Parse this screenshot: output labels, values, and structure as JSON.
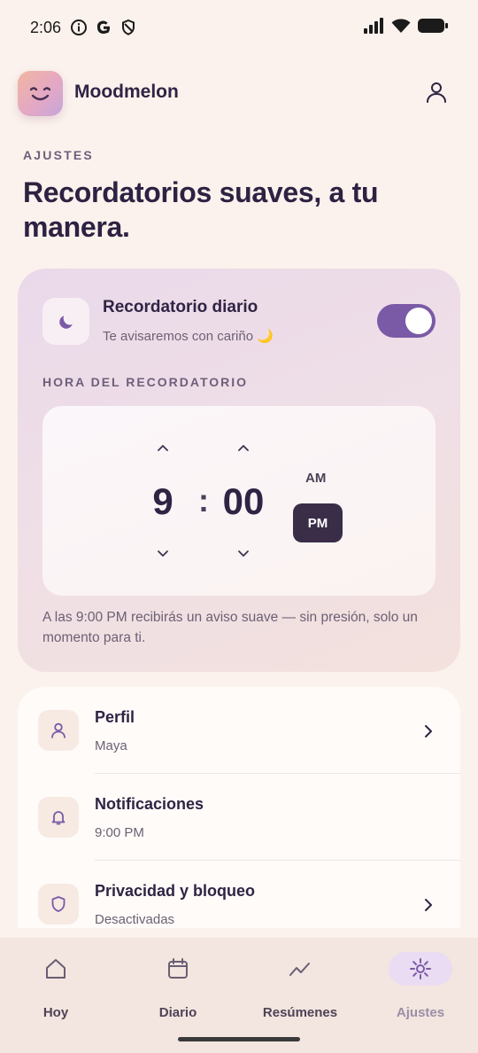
{
  "status_bar": {
    "time": "2:06",
    "icons": [
      "info-icon",
      "google-icon",
      "shield-icon",
      "signal-icon",
      "wifi-icon",
      "battery-icon"
    ]
  },
  "header": {
    "app_name": "Moodmelon",
    "logo_icon": "smile-face-icon",
    "profile_icon": "user-icon"
  },
  "page": {
    "eyebrow": "AJUSTES",
    "title": "Recordatorios suaves, a tu manera."
  },
  "reminder": {
    "title": "Recordatorio diario",
    "subtitle": "Te avisaremos con cariño 🌙",
    "enabled": true,
    "time_label": "HORA DEL RECORDATORIO",
    "hour": "9",
    "separator": ":",
    "minutes": "00",
    "am_label": "AM",
    "pm_label": "PM",
    "selected_period": "PM",
    "help_text": "A las 9:00 PM recibirás un aviso suave — sin presión, solo un momento para ti."
  },
  "settings": {
    "items": [
      {
        "title": "Perfil",
        "subtitle": "Maya",
        "icon": "user-icon",
        "has_chevron": true
      },
      {
        "title": "Notificaciones",
        "subtitle": "9:00 PM",
        "icon": "bell-icon",
        "has_chevron": false
      },
      {
        "title": "Privacidad y bloqueo",
        "subtitle": "Desactivadas",
        "icon": "shield-icon",
        "has_chevron": true
      }
    ]
  },
  "nav": {
    "items": [
      {
        "label": "Hoy",
        "icon": "home-icon",
        "active": false
      },
      {
        "label": "Diario",
        "icon": "calendar-icon",
        "active": false
      },
      {
        "label": "Resúmenes",
        "icon": "trend-icon",
        "active": false
      },
      {
        "label": "Ajustes",
        "icon": "gear-icon",
        "active": true
      }
    ]
  },
  "colors": {
    "accent": "#7a5aa6",
    "primary_text": "#2f2444",
    "background": "#fbf2ed",
    "pm_selected": "#3a2d48"
  }
}
